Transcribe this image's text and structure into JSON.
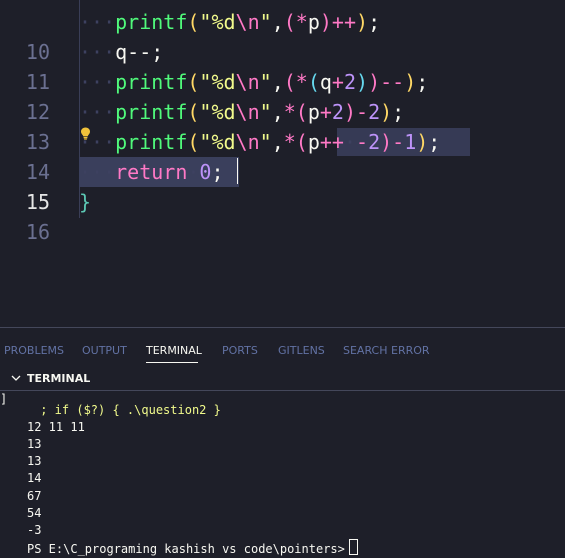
{
  "editor": {
    "line_numbers": [
      "10",
      "11",
      "12",
      "13",
      "14",
      "15",
      "16"
    ],
    "lines": [
      {
        "fn": "printf",
        "str": "\"%d",
        "esc": "\\n",
        "strend": "\"",
        "rest": [
          ",",
          "(",
          "*",
          "p",
          ")",
          "++",
          ")",
          ";"
        ]
      },
      {
        "text": "q--;"
      },
      {
        "fn": "printf",
        "str": "\"%d",
        "esc": "\\n",
        "strend": "\""
      },
      {
        "fn": "printf",
        "str": "\"%d",
        "esc": "\\n",
        "strend": "\""
      },
      {
        "fn": "printf",
        "str": "\"%d",
        "esc": "\\n",
        "strend": "\""
      },
      {
        "kw": "return",
        "num": "0",
        "end": ";"
      },
      {
        "brace": "}"
      }
    ],
    "line12_tail": {
      "open": ",(",
      "star": "*",
      "p1": "(",
      "q": "q",
      "plus": "+",
      "two": "2",
      "p2": ")",
      "p3": ")",
      "mm": "--",
      "close": ");"
    },
    "line13_tail": {
      "a": ",",
      "star": "*",
      "p1": "(",
      "p": "p",
      "plus": "+",
      "two": "2",
      "p2": ")",
      "minus": "-",
      "two2": "2",
      "close": ");"
    },
    "line14_tail": {
      "a": ",",
      "star": "*",
      "p1": "(",
      "p": "p",
      "pp": "++",
      "sp": " ",
      "minus": "-",
      "two": "2",
      "p2": ")",
      "minus2": "-",
      "one": "1",
      "close": ");"
    }
  },
  "panel": {
    "tabs": [
      {
        "label": "PROBLEMS"
      },
      {
        "label": "OUTPUT"
      },
      {
        "label": "TERMINAL"
      },
      {
        "label": "PORTS"
      },
      {
        "label": "GITLENS"
      },
      {
        "label": "SEARCH ERROR"
      }
    ],
    "section_title": "TERMINAL"
  },
  "terminal": {
    "left_mark": "]",
    "command_tail": " ; if ($?) { .\\question2 }",
    "output": [
      "12 11 11",
      "13",
      "13",
      "14",
      "67",
      "54",
      "-3"
    ],
    "prompt": "PS E:\\C_programing kashish vs code\\pointers>"
  },
  "colors": {
    "background": "#1e1f29",
    "function": "#50fa7b",
    "string": "#f1fa8c",
    "keyword": "#ff79c6",
    "number": "#bd93f9"
  }
}
